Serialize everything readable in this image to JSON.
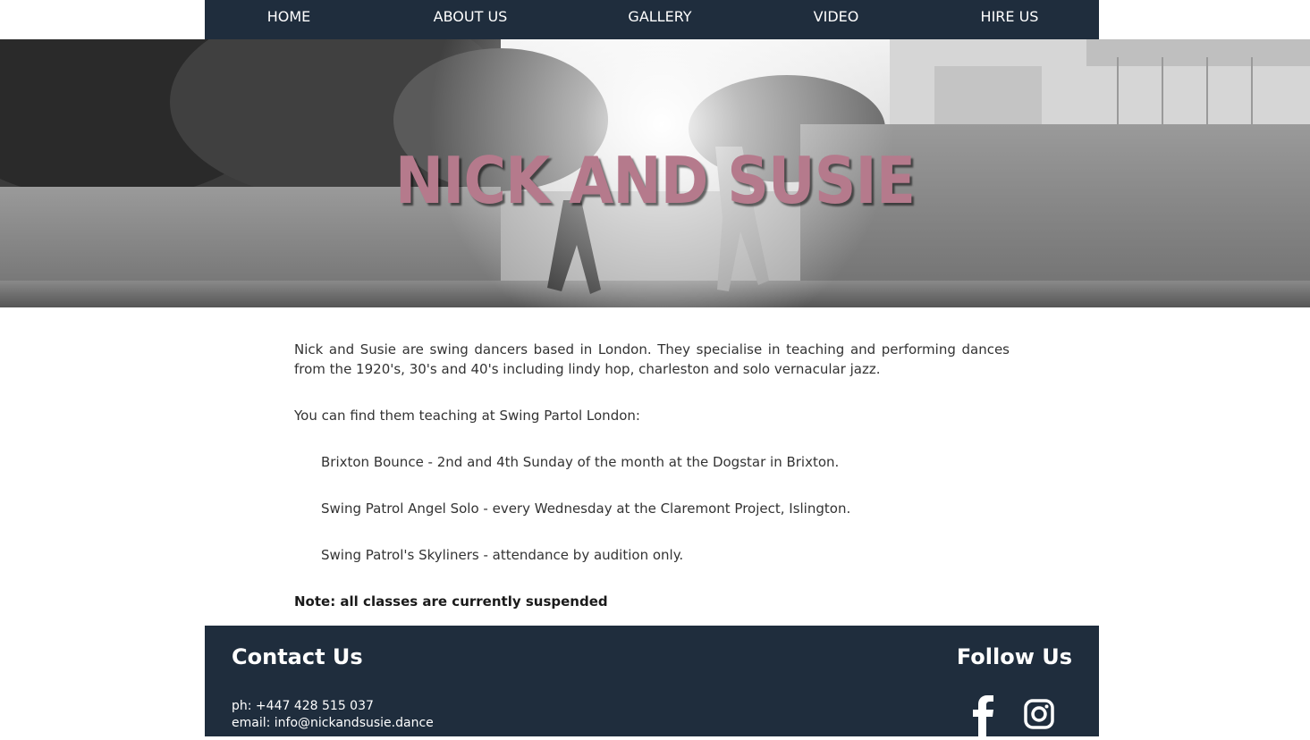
{
  "nav": {
    "items": [
      {
        "label": "HOME"
      },
      {
        "label": "ABOUT US"
      },
      {
        "label": "GALLERY"
      },
      {
        "label": "VIDEO"
      },
      {
        "label": "HIRE US"
      }
    ]
  },
  "hero": {
    "title": "NICK AND SUSIE",
    "title_color": "#b57a8c"
  },
  "content": {
    "intro": "Nick and Susie are swing dancers based in London. They specialise in teaching and performing dances from the 1920's, 30's and 40's including lindy hop, charleston and solo vernacular jazz.",
    "teaching_intro": "You can find them teaching at Swing Partol London:",
    "classes": [
      "Brixton Bounce - 2nd and 4th Sunday of the month at the Dogstar in Brixton.",
      "Swing Patrol Angel Solo - every Wednesday at the Claremont Project, Islington.",
      "Swing Patrol's Skyliners - attendance by audition only."
    ],
    "note": "Note: all classes are currently suspended"
  },
  "footer": {
    "contact_heading": "Contact Us",
    "phone": "ph: +447 428 515 037",
    "email": "email: info@nickandsusie.dance",
    "follow_heading": "Follow Us",
    "social": [
      "facebook-icon",
      "instagram-icon"
    ],
    "background": "#1f2d3d"
  }
}
